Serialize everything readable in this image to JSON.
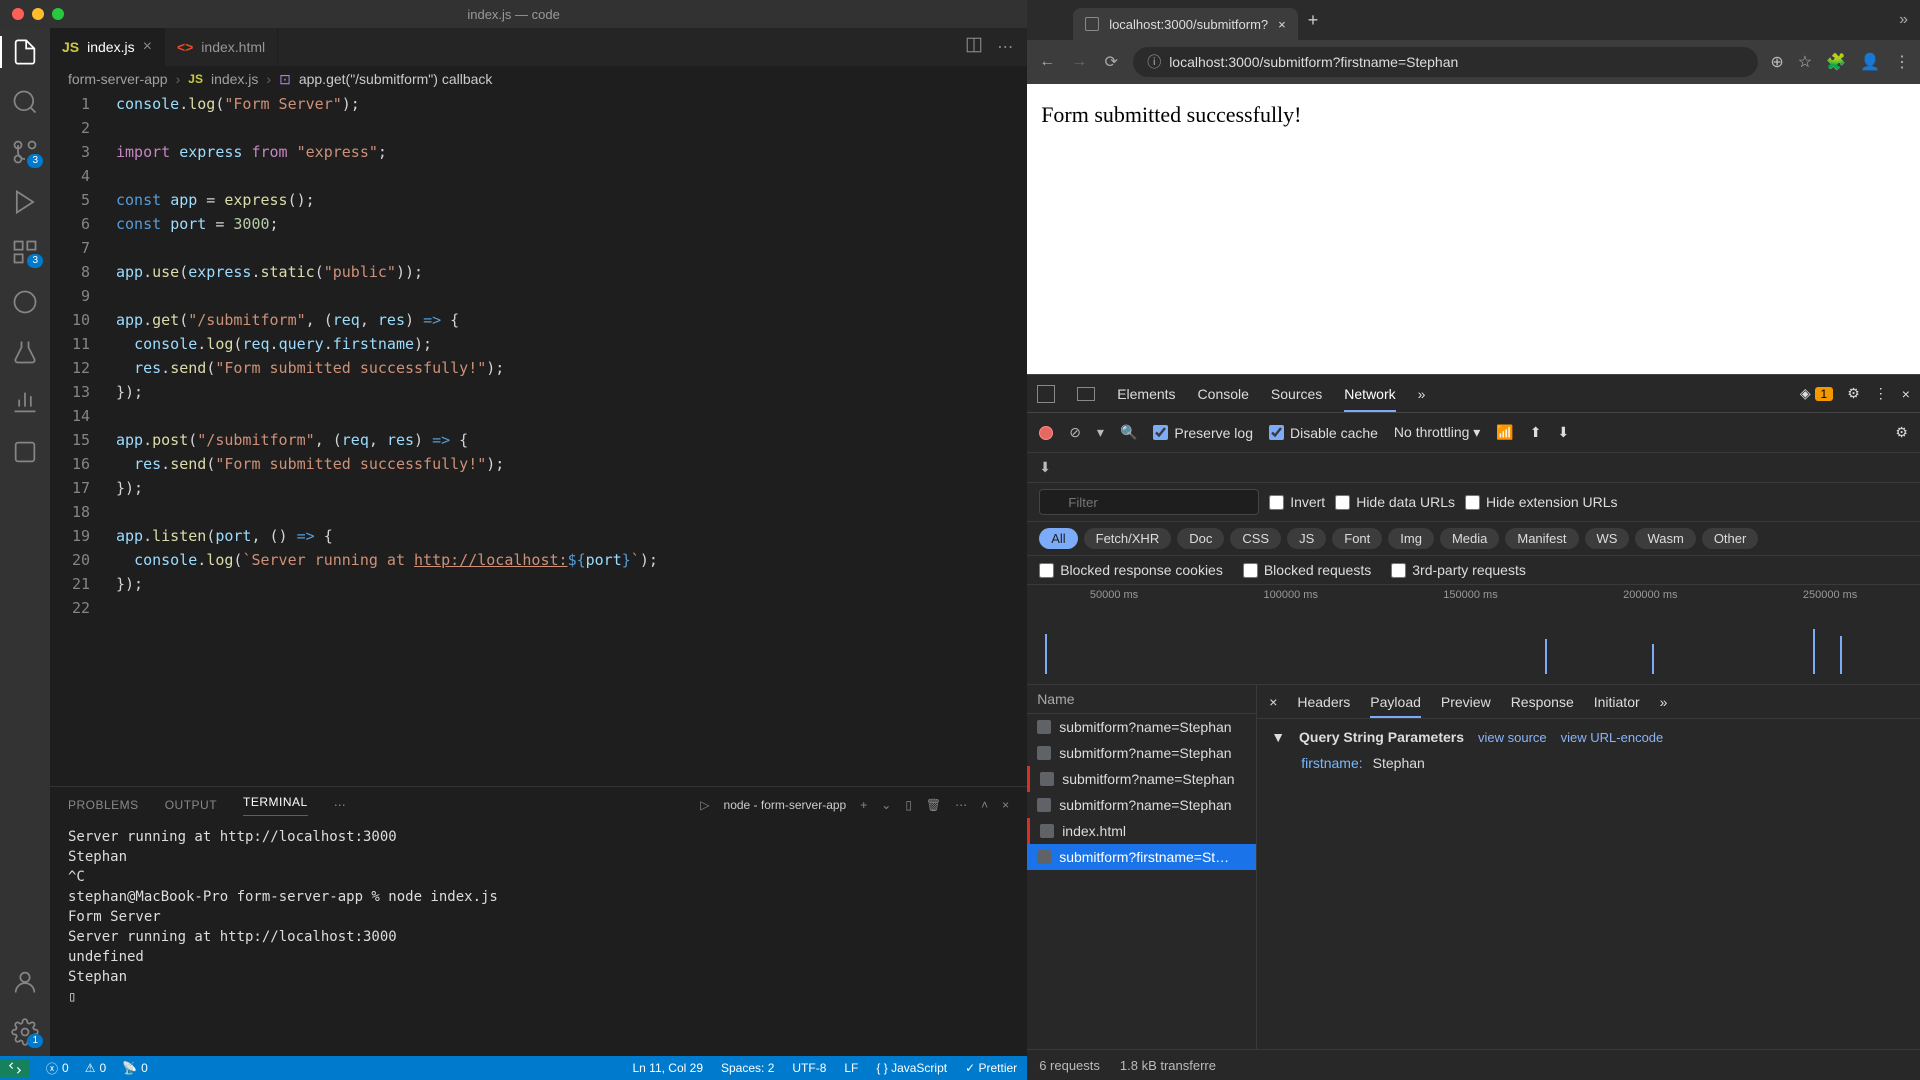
{
  "vscode": {
    "title": "index.js — code",
    "tabs": [
      {
        "icon": "JS",
        "label": "index.js",
        "active": true
      },
      {
        "icon": "<>",
        "label": "index.html",
        "active": false
      }
    ],
    "breadcrumb": {
      "folder": "form-server-app",
      "file": "index.js",
      "symbol": "app.get(\"/submitform\") callback"
    },
    "activity_badges": {
      "scm": "3",
      "gear": "1"
    },
    "code_lines": [
      {
        "n": 1,
        "html": "<span class='v'>console</span>.<span class='fn'>log</span>(<span class='s'>\"Form Server\"</span>);"
      },
      {
        "n": 2,
        "html": ""
      },
      {
        "n": 3,
        "html": "<span class='k'>import</span> <span class='v'>express</span> <span class='k'>from</span> <span class='s'>\"express\"</span>;"
      },
      {
        "n": 4,
        "html": ""
      },
      {
        "n": 5,
        "html": "<span class='kw'>const</span> <span class='v'>app</span> = <span class='fn'>express</span>();"
      },
      {
        "n": 6,
        "html": "<span class='kw'>const</span> <span class='v'>port</span> = <span class='n'>3000</span>;"
      },
      {
        "n": 7,
        "html": ""
      },
      {
        "n": 8,
        "html": "<span class='v'>app</span>.<span class='fn'>use</span>(<span class='v'>express</span>.<span class='fn'>static</span>(<span class='s'>\"public\"</span>));"
      },
      {
        "n": 9,
        "html": ""
      },
      {
        "n": 10,
        "html": "<span class='v'>app</span>.<span class='fn'>get</span>(<span class='s'>\"/submitform\"</span>, (<span class='v'>req</span>, <span class='v'>res</span>) <span class='kw'>=></span> {"
      },
      {
        "n": 11,
        "html": "  <span class='v'>console</span>.<span class='fn'>log</span>(<span class='v'>req</span>.<span class='v'>query</span>.<span class='v'>firstname</span>);"
      },
      {
        "n": 12,
        "html": "  <span class='v'>res</span>.<span class='fn'>send</span>(<span class='s'>\"Form submitted successfully!\"</span>);"
      },
      {
        "n": 13,
        "html": "});"
      },
      {
        "n": 14,
        "html": ""
      },
      {
        "n": 15,
        "html": "<span class='v'>app</span>.<span class='fn'>post</span>(<span class='s'>\"/submitform\"</span>, (<span class='v'>req</span>, <span class='v'>res</span>) <span class='kw'>=></span> {"
      },
      {
        "n": 16,
        "html": "  <span class='v'>res</span>.<span class='fn'>send</span>(<span class='s'>\"Form submitted successfully!\"</span>);"
      },
      {
        "n": 17,
        "html": "});"
      },
      {
        "n": 18,
        "html": ""
      },
      {
        "n": 19,
        "html": "<span class='v'>app</span>.<span class='fn'>listen</span>(<span class='v'>port</span>, () <span class='kw'>=></span> {"
      },
      {
        "n": 20,
        "html": "  <span class='v'>console</span>.<span class='fn'>log</span>(<span class='s'>`Server running at </span><span class='url'>http://localhost:</span><span class='kw'>${</span><span class='v'>port</span><span class='kw'>}</span><span class='s'>`</span>);"
      },
      {
        "n": 21,
        "html": "});"
      },
      {
        "n": 22,
        "html": ""
      }
    ],
    "panel": {
      "tabs": [
        "PROBLEMS",
        "OUTPUT",
        "TERMINAL"
      ],
      "active_tab": "TERMINAL",
      "selector": "node - form-server-app",
      "terminal": "Server running at http://localhost:3000\nStephan\n^C\nstephan@MacBook-Pro form-server-app % node index.js\nForm Server\nServer running at http://localhost:3000\nundefined\nStephan\n▯"
    },
    "statusbar": {
      "errors": "0",
      "warnings": "0",
      "ports": "0",
      "cursor": "Ln 11, Col 29",
      "spaces": "Spaces: 2",
      "encoding": "UTF-8",
      "eol": "LF",
      "lang": "JavaScript",
      "prettier": "Prettier"
    }
  },
  "chrome": {
    "tab_title": "localhost:3000/submitform?",
    "url": "localhost:3000/submitform?firstname=Stephan",
    "page_text": "Form submitted successfully!",
    "devtools": {
      "tabs": [
        "Elements",
        "Console",
        "Sources",
        "Network"
      ],
      "active_tab": "Network",
      "issues_count": "1",
      "controls": {
        "preserve_log": "Preserve log",
        "disable_cache": "Disable cache",
        "throttling": "No throttling"
      },
      "filter_placeholder": "Filter",
      "filter_options": {
        "invert": "Invert",
        "hide_data": "Hide data URLs",
        "hide_ext": "Hide extension URLs"
      },
      "chips": [
        "All",
        "Fetch/XHR",
        "Doc",
        "CSS",
        "JS",
        "Font",
        "Img",
        "Media",
        "Manifest",
        "WS",
        "Wasm",
        "Other"
      ],
      "blocked": {
        "cookies": "Blocked response cookies",
        "requests": "Blocked requests",
        "thirdparty": "3rd-party requests"
      },
      "timeline_ticks": [
        "50000 ms",
        "100000 ms",
        "150000 ms",
        "200000 ms",
        "250000 ms"
      ],
      "requests_header": "Name",
      "requests": [
        {
          "name": "submitform?name=Stephan",
          "err": false
        },
        {
          "name": "submitform?name=Stephan",
          "err": false
        },
        {
          "name": "submitform?name=Stephan",
          "err": true
        },
        {
          "name": "submitform?name=Stephan",
          "err": false
        },
        {
          "name": "index.html",
          "err": true
        },
        {
          "name": "submitform?firstname=St…",
          "err": false,
          "selected": true
        }
      ],
      "detail_tabs": [
        "Headers",
        "Payload",
        "Preview",
        "Response",
        "Initiator"
      ],
      "detail_active": "Payload",
      "payload": {
        "section": "Query String Parameters",
        "view_source": "view source",
        "view_urlenc": "view URL-encode",
        "key": "firstname:",
        "val": "Stephan"
      },
      "status": {
        "reqs": "6 requests",
        "transfer": "1.8 kB transferre"
      }
    }
  }
}
